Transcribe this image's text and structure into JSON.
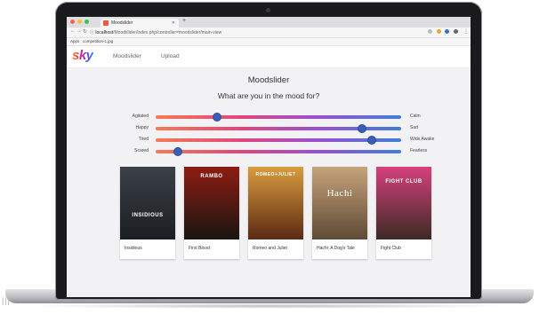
{
  "browser": {
    "tab_title": "Moodslider",
    "url_host": "localhost",
    "url_path": "/Moodslider/index.php/controller=moodslider/main-view",
    "bookmarks": [
      "Apps",
      "competition-1.jpg"
    ]
  },
  "app": {
    "logo": "sky",
    "nav": [
      "Moodslider",
      "Upload"
    ],
    "title": "Moodslider",
    "question": "What are you in the mood for?"
  },
  "sliders": [
    {
      "left": "Agitated",
      "right": "Calm",
      "value": 0.25
    },
    {
      "left": "Happy",
      "right": "Sad",
      "value": 0.84
    },
    {
      "left": "Tired",
      "right": "Wide Awake",
      "value": 0.88
    },
    {
      "left": "Scared",
      "right": "Fearless",
      "value": 0.09
    }
  ],
  "movies": [
    {
      "title": "Insidious",
      "poster_text": "INSIDIOUS",
      "colors": [
        "#3b4148",
        "#1b1e22"
      ]
    },
    {
      "title": "First Blood",
      "poster_text": "RAMBO",
      "colors": [
        "#8d1d12",
        "#1a1512"
      ]
    },
    {
      "title": "Romeo and Juliet",
      "poster_text": "ROMEO+JULIET",
      "colors": [
        "#d99c3e",
        "#5a2a14"
      ]
    },
    {
      "title": "Hachi: A Dog's Tale",
      "poster_text": "Hachi",
      "colors": [
        "#c6a47a",
        "#5e4a36"
      ]
    },
    {
      "title": "Fight Club",
      "poster_text": "FIGHT CLUB",
      "colors": [
        "#d6417d",
        "#3c2a24"
      ]
    }
  ],
  "colors": {
    "accent": "#3b5fb4",
    "track_start": "#f47b56",
    "track_end": "#3f7ed6"
  }
}
